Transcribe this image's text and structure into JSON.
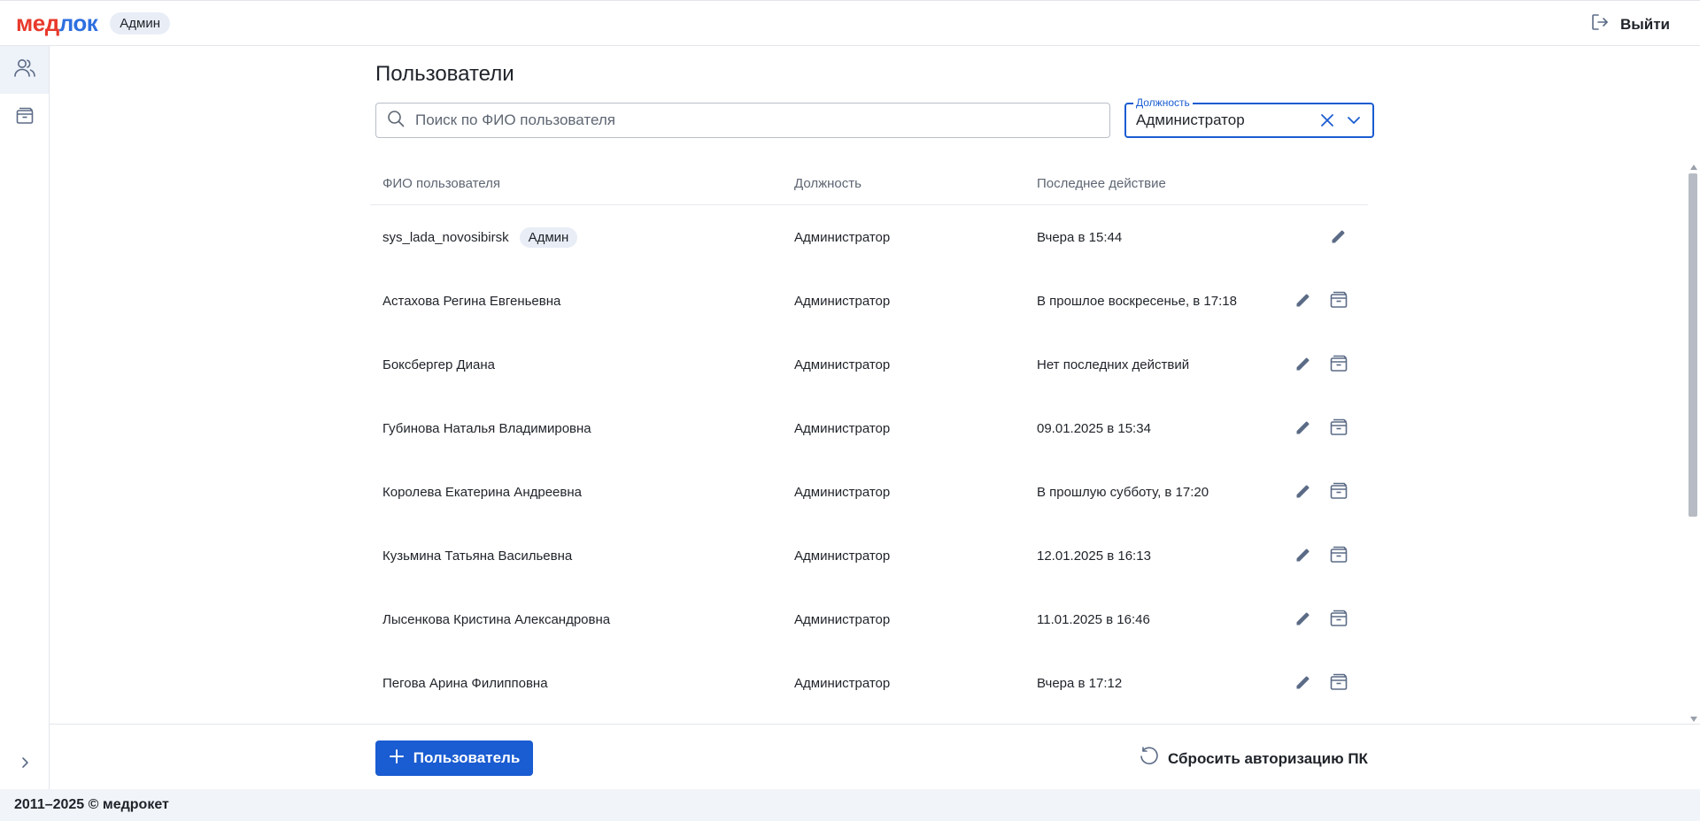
{
  "header": {
    "logo_part1": "мед",
    "logo_part2": "лок",
    "role_badge": "Админ",
    "logout_label": "Выйти"
  },
  "sidebar": {
    "items": [
      {
        "icon": "users-icon",
        "active": true
      },
      {
        "icon": "archive-icon",
        "active": false
      }
    ]
  },
  "main": {
    "title": "Пользователи",
    "search_placeholder": "Поиск по ФИО пользователя",
    "search_value": "",
    "filter": {
      "label": "Должность",
      "value": "Администратор"
    }
  },
  "table": {
    "columns": [
      "ФИО пользователя",
      "Должность",
      "Последнее действие"
    ],
    "rows": [
      {
        "name": "sys_lada_novosibirsk",
        "badge": "Админ",
        "position": "Администратор",
        "last": "Вчера в 15:44",
        "archive": false
      },
      {
        "name": "Астахова Регина Евгеньевна",
        "badge": "",
        "position": "Администратор",
        "last": "В прошлое воскресенье, в 17:18",
        "archive": true
      },
      {
        "name": "Боксбергер Диана",
        "badge": "",
        "position": "Администратор",
        "last": "Нет последних действий",
        "archive": true
      },
      {
        "name": "Губинова Наталья Владимировна",
        "badge": "",
        "position": "Администратор",
        "last": "09.01.2025 в 15:34",
        "archive": true
      },
      {
        "name": "Королева Екатерина Андреевна",
        "badge": "",
        "position": "Администратор",
        "last": "В прошлую субботу, в 17:20",
        "archive": true
      },
      {
        "name": "Кузьмина Татьяна Васильевна",
        "badge": "",
        "position": "Администратор",
        "last": "12.01.2025 в 16:13",
        "archive": true
      },
      {
        "name": "Лысенкова Кристина Александровна",
        "badge": "",
        "position": "Администратор",
        "last": "11.01.2025 в 16:46",
        "archive": true
      },
      {
        "name": "Пегова Арина Филипповна",
        "badge": "",
        "position": "Администратор",
        "last": "Вчера в 17:12",
        "archive": true
      }
    ]
  },
  "footer": {
    "add_user_label": "Пользователь",
    "reset_auth_label": "Сбросить авторизацию ПК",
    "copyright": "2011–2025 © медрокет"
  },
  "colors": {
    "primary": "#1a5cd1",
    "logo_red": "#e8392b",
    "logo_blue": "#2e6fe0",
    "icon_gray": "#5b6b86"
  }
}
